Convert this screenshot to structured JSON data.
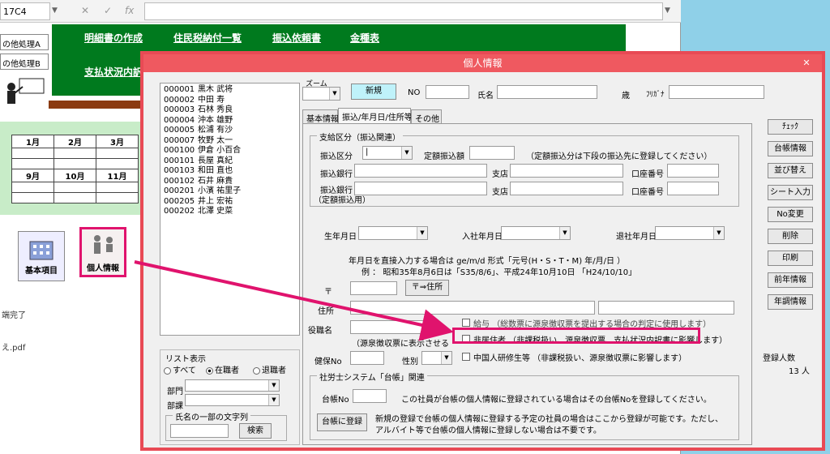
{
  "excel": {
    "namebox": "17C4",
    "formula_cancel": "✕",
    "formula_enter": "✓",
    "formula_fx": "fx",
    "side_buttons": [
      "の他処理A",
      "の他処理B"
    ],
    "green_links": [
      "明細書の作成",
      "住民税納付一覧",
      "振込依頼書",
      "金種表"
    ],
    "green_link2": "支払状況内訳",
    "calendar": [
      [
        "1月",
        "2月",
        "3月"
      ],
      [
        "",
        "",
        ""
      ],
      [
        "",
        "",
        ""
      ],
      [
        "9月",
        "10月",
        "11月"
      ],
      [
        "",
        "",
        ""
      ],
      [
        "",
        "",
        ""
      ]
    ],
    "icon_kihon": "基本項目",
    "icon_kojin": "個人情報",
    "status1": "端完了",
    "status2": "え.pdf"
  },
  "dialog": {
    "title": "個人情報",
    "close": "✕",
    "zoom_label": "ズーム",
    "new_button": "新規",
    "no_label": "NO",
    "name_label": "氏名",
    "age_suffix": "歳",
    "kana_label": "ﾌﾘｶﾞﾅ",
    "employees": [
      {
        "id": "000001",
        "name": "黒木 武将"
      },
      {
        "id": "000002",
        "name": "中田 寿"
      },
      {
        "id": "000003",
        "name": "石林 秀良"
      },
      {
        "id": "000004",
        "name": "沖本 雄野"
      },
      {
        "id": "000005",
        "name": "松浦 有沙"
      },
      {
        "id": "000007",
        "name": "牧野 太一"
      },
      {
        "id": "000100",
        "name": "伊倉 小百合"
      },
      {
        "id": "000101",
        "name": "長屋 真紀"
      },
      {
        "id": "000103",
        "name": "和田 直也"
      },
      {
        "id": "000102",
        "name": "石井 麻貴"
      },
      {
        "id": "000201",
        "name": "小濱 祐里子"
      },
      {
        "id": "000205",
        "name": "井上 宏祐"
      },
      {
        "id": "000202",
        "name": "北澤 史菜"
      }
    ],
    "list_filter": {
      "title": "リスト表示",
      "opt_all": "すべて",
      "opt_active": "在職者",
      "opt_retired": "退職者",
      "dept_label": "部門",
      "section_label": "部課",
      "search_group": "氏名の一部の文字列",
      "search_button": "検索"
    },
    "tabs": [
      "基本情報",
      "振込/年月日/住所等",
      "その他"
    ],
    "payment": {
      "group": "支給区分（振込関連）",
      "furikomi_kubun": "振込区分",
      "furikomi_kubun_value": "|",
      "teigaku_label": "定額振込額",
      "teigaku_note": "（定額振込分は下段の振込先に登録してください）",
      "bank1": "振込銀行",
      "branch1": "支店",
      "acct1": "口座番号",
      "bank2": "振込銀行",
      "bank2_sub": "（定額振込用）",
      "branch2": "支店",
      "acct2": "口座番号"
    },
    "dates": {
      "birth": "生年月日",
      "join": "入社年月日",
      "leave": "退社年月日",
      "note1": "年月日を直接入力する場合は ge/m/d  形式「元号(H・S・T・M)  年/月/日 ）",
      "note2": "例 ：  昭和35年8月6日は「S35/8/6」、平成24年10月10日  「H24/10/10」"
    },
    "address": {
      "postal_label": "〒",
      "postal_button": "〒⇒住所",
      "address_label": "住所",
      "kanji_label": "役職名"
    },
    "flags": {
      "kyuyo": "給与 （総数票に源泉徴収票を提出する場合の判定に使用します）",
      "kyuyo_prefix": "（源泉徴収票に表示させる",
      "non_resident": "非居住者  （非課税扱い、源泉徴収票、支払状況内訳書に影響します）",
      "kenpo_label": "健保No",
      "gender_label": "性別",
      "trainee": "中国人研修生等    （非課税扱い、源泉徴収票に影響します）"
    },
    "sharoushi": {
      "group": "社労士システム「台帳」関連",
      "daicho_label": "台帳No",
      "daicho_note": "この社員が台帳の個人情報に登録されている場合はその台帳Noを登録してください。",
      "register_button": "台帳に登録",
      "register_note1": "新規の登録で台帳の個人情報に登録する予定の社員の場合はここから登録が可能です。ただし、",
      "register_note2": "アルバイト等で台帳の個人情報に登録しない場合は不要です。"
    },
    "right_buttons": [
      "ﾁｪｯｸ",
      "台帳情報",
      "並び替え",
      "シート入力",
      "No変更",
      "削除",
      "印刷",
      "前年情報",
      "年調情報"
    ],
    "count_label": "登録人数",
    "count_value": "13 人"
  }
}
